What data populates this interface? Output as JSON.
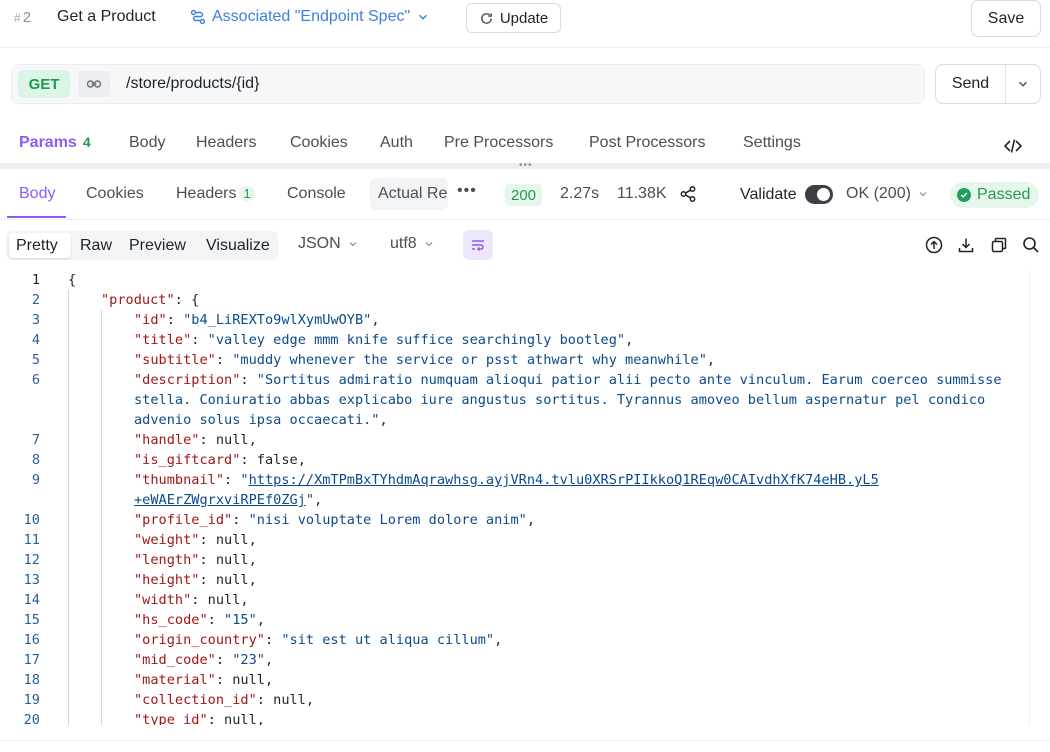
{
  "header": {
    "endpoint_number": "2",
    "endpoint_name": "Get a Product",
    "associated_label": "Associated \"Endpoint Spec\"",
    "update_label": "Update",
    "save_label": "Save"
  },
  "request": {
    "method": "GET",
    "url": "/store/products/{id}",
    "send_label": "Send"
  },
  "request_tabs": {
    "params": "Params",
    "params_count": "4",
    "body": "Body",
    "headers": "Headers",
    "cookies": "Cookies",
    "auth": "Auth",
    "pre_processors": "Pre Processors",
    "post_processors": "Post Processors",
    "settings": "Settings"
  },
  "response_tabs": {
    "body": "Body",
    "cookies": "Cookies",
    "headers": "Headers",
    "headers_count": "1",
    "console": "Console",
    "actual_request": "Actual Request"
  },
  "response_meta": {
    "status_code": "200",
    "time": "2.27s",
    "size": "11.38K",
    "validate_label": "Validate",
    "ok_status": "OK (200)",
    "passed_label": "Passed"
  },
  "view_toolbar": {
    "pretty": "Pretty",
    "raw": "Raw",
    "preview": "Preview",
    "visualize": "Visualize",
    "format": "JSON",
    "encoding": "utf8"
  },
  "code_lines": [
    {
      "n": "1",
      "indent": 0,
      "parts": [
        {
          "t": "p",
          "v": "{"
        }
      ]
    },
    {
      "n": "2",
      "indent": 1,
      "parts": [
        {
          "t": "k",
          "v": "\"product\""
        },
        {
          "t": "p",
          "v": ": {"
        }
      ]
    },
    {
      "n": "3",
      "indent": 2,
      "parts": [
        {
          "t": "k",
          "v": "\"id\""
        },
        {
          "t": "p",
          "v": ": "
        },
        {
          "t": "s",
          "v": "\"b4_LiREXTo9wlXymUwOYB\""
        },
        {
          "t": "p",
          "v": ","
        }
      ]
    },
    {
      "n": "4",
      "indent": 2,
      "parts": [
        {
          "t": "k",
          "v": "\"title\""
        },
        {
          "t": "p",
          "v": ": "
        },
        {
          "t": "s",
          "v": "\"valley edge mmm knife suffice searchingly bootleg\""
        },
        {
          "t": "p",
          "v": ","
        }
      ]
    },
    {
      "n": "5",
      "indent": 2,
      "parts": [
        {
          "t": "k",
          "v": "\"subtitle\""
        },
        {
          "t": "p",
          "v": ": "
        },
        {
          "t": "s",
          "v": "\"muddy whenever the service or psst athwart why meanwhile\""
        },
        {
          "t": "p",
          "v": ","
        }
      ]
    },
    {
      "n": "6",
      "indent": 2,
      "parts": [
        {
          "t": "k",
          "v": "\"description\""
        },
        {
          "t": "p",
          "v": ": "
        },
        {
          "t": "s",
          "v": "\"Sortitus admiratio numquam alioqui patior alii pecto ante vinculum. Earum coerceo summisse"
        }
      ]
    },
    {
      "n": "",
      "indent": 2,
      "parts": [
        {
          "t": "s",
          "v": "stella. Coniuratio abbas explicabo iure angustus sortitus. Tyrannus amoveo bellum aspernatur pel condico"
        }
      ]
    },
    {
      "n": "",
      "indent": 2,
      "parts": [
        {
          "t": "s",
          "v": "advenio solus ipsa occaecati.\""
        },
        {
          "t": "p",
          "v": ","
        }
      ]
    },
    {
      "n": "7",
      "indent": 2,
      "parts": [
        {
          "t": "k",
          "v": "\"handle\""
        },
        {
          "t": "p",
          "v": ": null,"
        }
      ]
    },
    {
      "n": "8",
      "indent": 2,
      "parts": [
        {
          "t": "k",
          "v": "\"is_giftcard\""
        },
        {
          "t": "p",
          "v": ": false,"
        }
      ]
    },
    {
      "n": "9",
      "indent": 2,
      "parts": [
        {
          "t": "k",
          "v": "\"thumbnail\""
        },
        {
          "t": "p",
          "v": ": "
        },
        {
          "t": "s",
          "v": "\""
        },
        {
          "t": "u",
          "v": "https://XmTPmBxTYhdmAqrawhsg.ayjVRn4.tvlu0XRSrPIIkkoQ1REqw0CAIvdhXfK74eHB.yL5"
        }
      ]
    },
    {
      "n": "",
      "indent": 2,
      "parts": [
        {
          "t": "u",
          "v": "+eWAErZWgrxviRPEf0ZGj"
        },
        {
          "t": "s",
          "v": "\""
        },
        {
          "t": "p",
          "v": ","
        }
      ]
    },
    {
      "n": "10",
      "indent": 2,
      "parts": [
        {
          "t": "k",
          "v": "\"profile_id\""
        },
        {
          "t": "p",
          "v": ": "
        },
        {
          "t": "s",
          "v": "\"nisi voluptate Lorem dolore anim\""
        },
        {
          "t": "p",
          "v": ","
        }
      ]
    },
    {
      "n": "11",
      "indent": 2,
      "parts": [
        {
          "t": "k",
          "v": "\"weight\""
        },
        {
          "t": "p",
          "v": ": null,"
        }
      ]
    },
    {
      "n": "12",
      "indent": 2,
      "parts": [
        {
          "t": "k",
          "v": "\"length\""
        },
        {
          "t": "p",
          "v": ": null,"
        }
      ]
    },
    {
      "n": "13",
      "indent": 2,
      "parts": [
        {
          "t": "k",
          "v": "\"height\""
        },
        {
          "t": "p",
          "v": ": null,"
        }
      ]
    },
    {
      "n": "14",
      "indent": 2,
      "parts": [
        {
          "t": "k",
          "v": "\"width\""
        },
        {
          "t": "p",
          "v": ": null,"
        }
      ]
    },
    {
      "n": "15",
      "indent": 2,
      "parts": [
        {
          "t": "k",
          "v": "\"hs_code\""
        },
        {
          "t": "p",
          "v": ": "
        },
        {
          "t": "s",
          "v": "\"15\""
        },
        {
          "t": "p",
          "v": ","
        }
      ]
    },
    {
      "n": "16",
      "indent": 2,
      "parts": [
        {
          "t": "k",
          "v": "\"origin_country\""
        },
        {
          "t": "p",
          "v": ": "
        },
        {
          "t": "s",
          "v": "\"sit est ut aliqua cillum\""
        },
        {
          "t": "p",
          "v": ","
        }
      ]
    },
    {
      "n": "17",
      "indent": 2,
      "parts": [
        {
          "t": "k",
          "v": "\"mid_code\""
        },
        {
          "t": "p",
          "v": ": "
        },
        {
          "t": "s",
          "v": "\"23\""
        },
        {
          "t": "p",
          "v": ","
        }
      ]
    },
    {
      "n": "18",
      "indent": 2,
      "parts": [
        {
          "t": "k",
          "v": "\"material\""
        },
        {
          "t": "p",
          "v": ": null,"
        }
      ]
    },
    {
      "n": "19",
      "indent": 2,
      "parts": [
        {
          "t": "k",
          "v": "\"collection_id\""
        },
        {
          "t": "p",
          "v": ": null,"
        }
      ]
    },
    {
      "n": "20",
      "indent": 2,
      "parts": [
        {
          "t": "k",
          "v": "\"type_id\""
        },
        {
          "t": "p",
          "v": ": null,"
        }
      ]
    }
  ]
}
